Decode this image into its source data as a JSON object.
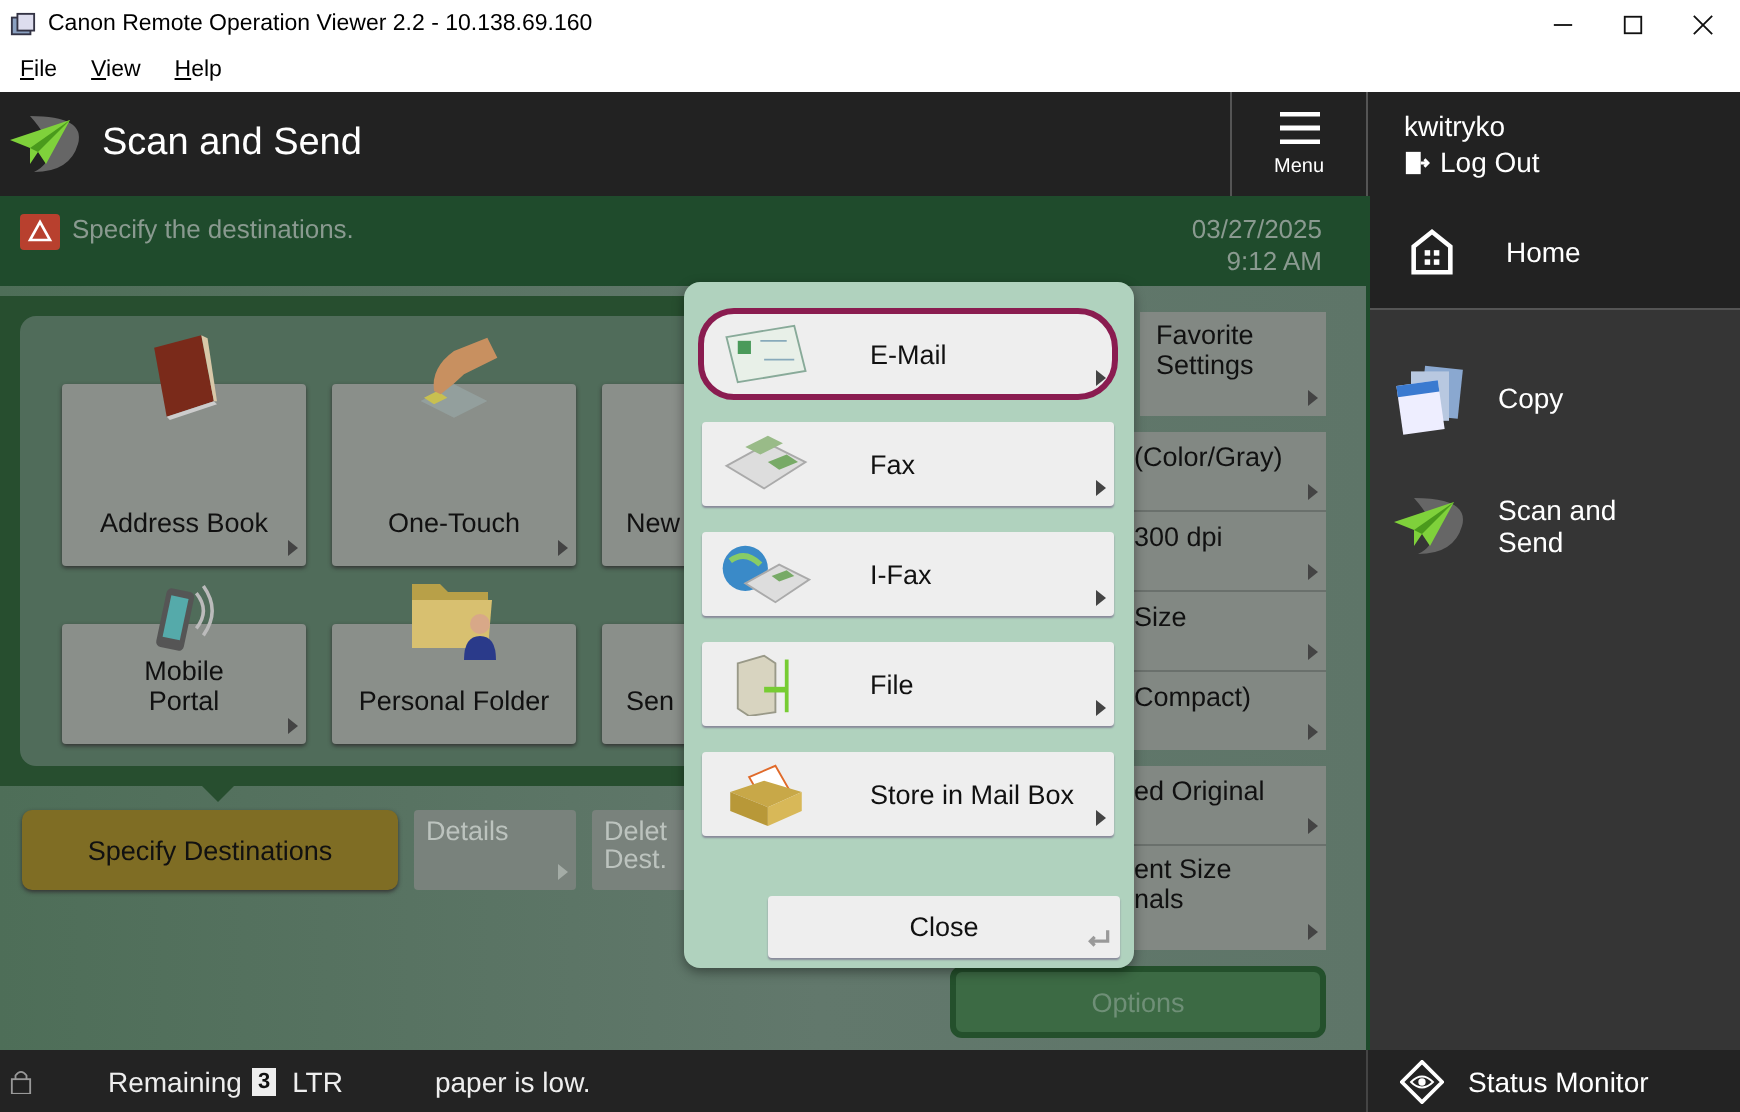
{
  "window": {
    "title": "Canon Remote Operation Viewer 2.2 - 10.138.69.160"
  },
  "menu_bar": [
    "File",
    "View",
    "Help"
  ],
  "header": {
    "title": "Scan and Send",
    "menu_label": "Menu"
  },
  "user": {
    "name": "kwitryko",
    "logout": "Log Out"
  },
  "message": {
    "text": "Specify the destinations.",
    "date": "03/27/2025",
    "time": "9:12 AM"
  },
  "destination_tiles": [
    {
      "label": "Address Book",
      "arrow": true,
      "kind": "book"
    },
    {
      "label": "One-Touch",
      "arrow": true,
      "kind": "hand"
    },
    {
      "label": "New",
      "arrow": false,
      "kind": "partial"
    },
    {
      "label": "Mobile\nPortal",
      "arrow": true,
      "kind": "phone"
    },
    {
      "label": "Personal Folder",
      "arrow": false,
      "kind": "folder"
    },
    {
      "label": "Sen",
      "arrow": false,
      "kind": "partial"
    }
  ],
  "actions": [
    {
      "label": "Specify Destinations",
      "kind": "primary",
      "arrow": false
    },
    {
      "label": "Details",
      "kind": "disabled",
      "arrow": true
    },
    {
      "label": "Delet\nDest.",
      "kind": "disabled",
      "arrow": false
    }
  ],
  "settings_groups": [
    [
      {
        "label": "Favorite\nSettings"
      }
    ],
    [
      {
        "label": "(Color/Gray)"
      },
      {
        "label": "300 dpi"
      },
      {
        "label": "Size"
      },
      {
        "label": "Compact)"
      }
    ],
    [
      {
        "label": "ed Original"
      },
      {
        "label": "ent Size\nnals"
      }
    ]
  ],
  "options_label": "Options",
  "send_menu": {
    "items": [
      {
        "label": "E-Mail",
        "kind": "email",
        "selected": true
      },
      {
        "label": "Fax",
        "kind": "fax",
        "selected": false
      },
      {
        "label": "I-Fax",
        "kind": "ifax",
        "selected": false
      },
      {
        "label": "File",
        "kind": "file",
        "selected": false
      },
      {
        "label": "Store in Mail Box",
        "kind": "mailbox",
        "selected": false
      }
    ],
    "close": "Close"
  },
  "sidebar": {
    "items": [
      {
        "label": "Home",
        "kind": "home"
      },
      {
        "label": "Copy",
        "kind": "copy"
      },
      {
        "label": "Scan and\nSend",
        "kind": "send"
      }
    ]
  },
  "status_bar": {
    "remaining": "Remaining",
    "count": "3",
    "paper": "LTR",
    "message": "paper is low.",
    "status_monitor": "Status Monitor"
  }
}
